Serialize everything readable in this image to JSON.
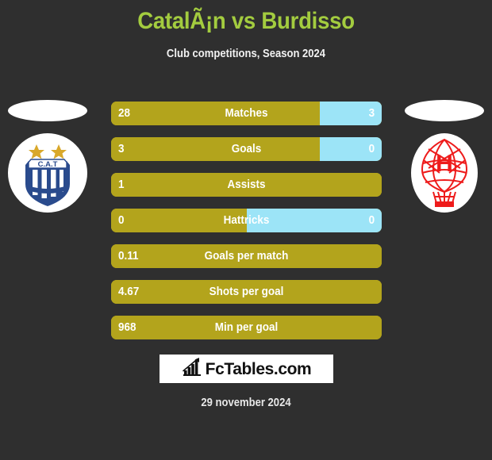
{
  "header": {
    "title": "CatalÃ¡n vs Burdisso",
    "subtitle": "Club competitions, Season 2024",
    "title_color": "#a3cc3f"
  },
  "teams": {
    "left": {
      "name": "C.A.T",
      "logo_icon": "talleres-crest-icon",
      "colors": {
        "shield": "#2a4b8d",
        "star": "#d9a82a",
        "field": "#ffffff"
      }
    },
    "right": {
      "name": "H",
      "logo_icon": "huracan-balloon-icon",
      "colors": {
        "balloon": "#ee1b1b",
        "field": "#ffffff"
      }
    }
  },
  "colors": {
    "background": "#2f2f2f",
    "bar_left": "#b3a41c",
    "bar_right": "#9ce4f7",
    "text": "#ffffff"
  },
  "chart_data": {
    "type": "bar",
    "title": "CatalÃ¡n vs Burdisso",
    "subtitle": "Club competitions, Season 2024",
    "orientation": "horizontal-diverging",
    "series": [
      {
        "name": "CatalÃ¡n",
        "color": "#b3a41c"
      },
      {
        "name": "Burdisso",
        "color": "#9ce4f7"
      }
    ],
    "categories": [
      "Matches",
      "Goals",
      "Assists",
      "Hattricks",
      "Goals per match",
      "Shots per goal",
      "Min per goal"
    ],
    "rows": [
      {
        "label": "Matches",
        "left_value": "28",
        "right_value": "3",
        "left_pct": 77,
        "has_right": true
      },
      {
        "label": "Goals",
        "left_value": "3",
        "right_value": "0",
        "left_pct": 77,
        "has_right": true
      },
      {
        "label": "Assists",
        "left_value": "1",
        "right_value": "",
        "left_pct": 100,
        "has_right": false
      },
      {
        "label": "Hattricks",
        "left_value": "0",
        "right_value": "0",
        "left_pct": 50,
        "has_right": true
      },
      {
        "label": "Goals per match",
        "left_value": "0.11",
        "right_value": "",
        "left_pct": 100,
        "has_right": false
      },
      {
        "label": "Shots per goal",
        "left_value": "4.67",
        "right_value": "",
        "left_pct": 100,
        "has_right": false
      },
      {
        "label": "Min per goal",
        "left_value": "968",
        "right_value": "",
        "left_pct": 100,
        "has_right": false
      }
    ]
  },
  "footer": {
    "brand": "FcTables.com",
    "brand_icon": "bar-chart-icon",
    "date": "29 november 2024"
  }
}
